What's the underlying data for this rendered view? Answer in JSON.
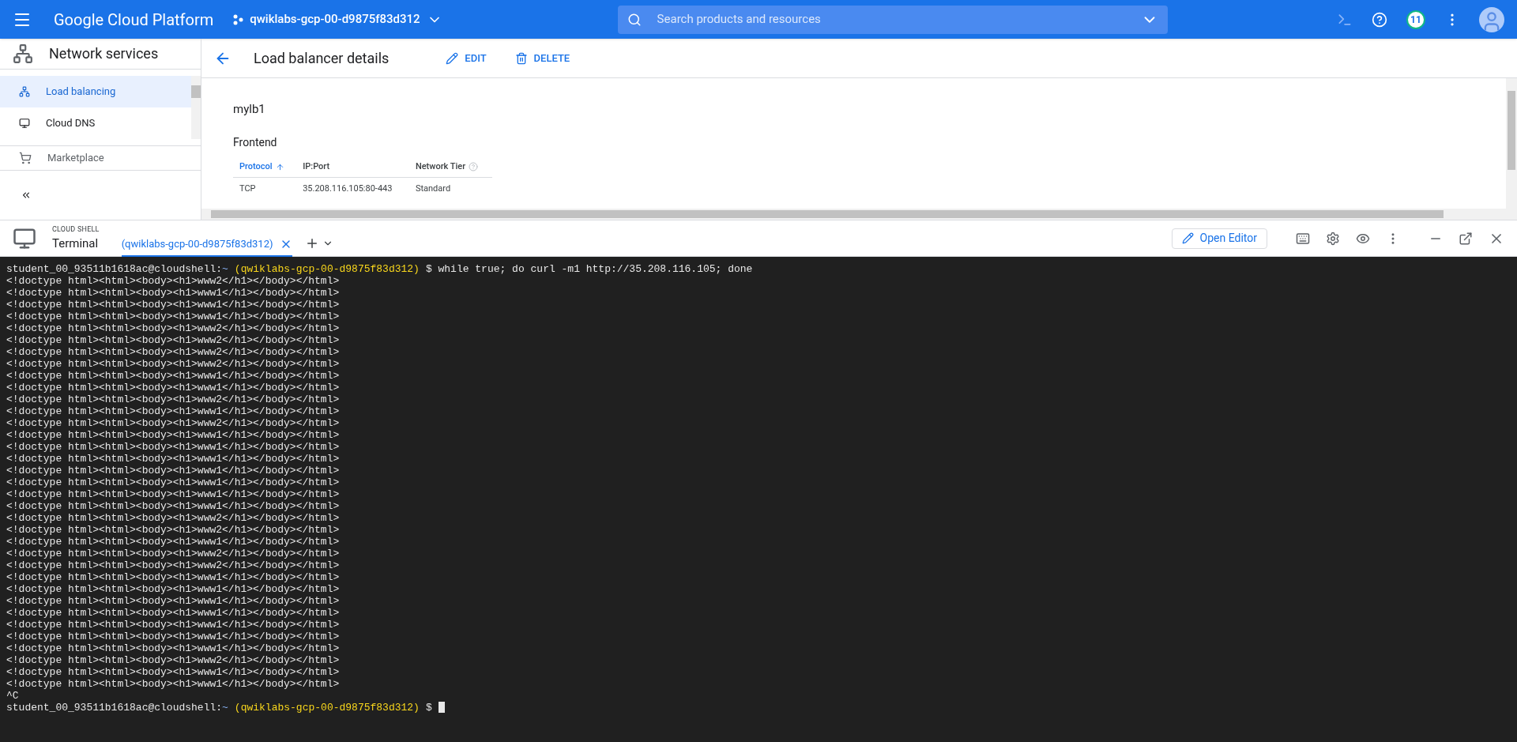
{
  "header": {
    "product": "Google Cloud Platform",
    "project": "qwiklabs-gcp-00-d9875f83d312",
    "search": {
      "placeholder": "Search products and resources"
    },
    "badge": "11"
  },
  "nav": {
    "title": "Network services",
    "items": [
      {
        "label": "Load balancing",
        "selected": true
      },
      {
        "label": "Cloud DNS",
        "selected": false
      }
    ],
    "extra": {
      "label": "Marketplace"
    }
  },
  "page": {
    "title": "Load balancer details",
    "actions": [
      {
        "label": "EDIT",
        "kind": "edit"
      },
      {
        "label": "DELETE",
        "kind": "delete"
      }
    ],
    "name": "mylb1",
    "section": "Frontend",
    "table": {
      "columns": [
        {
          "label": "Protocol",
          "sorted": true,
          "help": false
        },
        {
          "label": "IP:Port",
          "sorted": false,
          "help": false
        },
        {
          "label": "Network Tier",
          "sorted": false,
          "help": true
        }
      ],
      "rows": [
        [
          "TCP",
          "35.208.116.105:80-443",
          "Standard"
        ]
      ]
    }
  },
  "shell": {
    "label": "CLOUD SHELL",
    "title": "Terminal",
    "tabs": [
      {
        "label": "(qwiklabs-gcp-00-d9875f83d312)",
        "selected": true
      }
    ],
    "open_editor": "Open Editor"
  },
  "terminal": {
    "lines": [
      {
        "kind": "prompt",
        "user": "student_00_93511b1618ac@cloudshell:",
        "dir": "~",
        "project": "(qwiklabs-gcp-00-d9875f83d312)",
        "command": "$ while true; do curl -m1 http://35.208.116.105; done",
        "cursor": false
      },
      {
        "kind": "output",
        "text": "<!doctype html><html><body><h1>www2</h1></body></html>"
      },
      {
        "kind": "output",
        "text": "<!doctype html><html><body><h1>www1</h1></body></html>"
      },
      {
        "kind": "output",
        "text": "<!doctype html><html><body><h1>www1</h1></body></html>"
      },
      {
        "kind": "output",
        "text": "<!doctype html><html><body><h1>www1</h1></body></html>"
      },
      {
        "kind": "output",
        "text": "<!doctype html><html><body><h1>www2</h1></body></html>"
      },
      {
        "kind": "output",
        "text": "<!doctype html><html><body><h1>www2</h1></body></html>"
      },
      {
        "kind": "output",
        "text": "<!doctype html><html><body><h1>www2</h1></body></html>"
      },
      {
        "kind": "output",
        "text": "<!doctype html><html><body><h1>www2</h1></body></html>"
      },
      {
        "kind": "output",
        "text": "<!doctype html><html><body><h1>www1</h1></body></html>"
      },
      {
        "kind": "output",
        "text": "<!doctype html><html><body><h1>www1</h1></body></html>"
      },
      {
        "kind": "output",
        "text": "<!doctype html><html><body><h1>www2</h1></body></html>"
      },
      {
        "kind": "output",
        "text": "<!doctype html><html><body><h1>www1</h1></body></html>"
      },
      {
        "kind": "output",
        "text": "<!doctype html><html><body><h1>www2</h1></body></html>"
      },
      {
        "kind": "output",
        "text": "<!doctype html><html><body><h1>www1</h1></body></html>"
      },
      {
        "kind": "output",
        "text": "<!doctype html><html><body><h1>www1</h1></body></html>"
      },
      {
        "kind": "output",
        "text": "<!doctype html><html><body><h1>www1</h1></body></html>"
      },
      {
        "kind": "output",
        "text": "<!doctype html><html><body><h1>www1</h1></body></html>"
      },
      {
        "kind": "output",
        "text": "<!doctype html><html><body><h1>www1</h1></body></html>"
      },
      {
        "kind": "output",
        "text": "<!doctype html><html><body><h1>www1</h1></body></html>"
      },
      {
        "kind": "output",
        "text": "<!doctype html><html><body><h1>www1</h1></body></html>"
      },
      {
        "kind": "output",
        "text": "<!doctype html><html><body><h1>www2</h1></body></html>"
      },
      {
        "kind": "output",
        "text": "<!doctype html><html><body><h1>www2</h1></body></html>"
      },
      {
        "kind": "output",
        "text": "<!doctype html><html><body><h1>www1</h1></body></html>"
      },
      {
        "kind": "output",
        "text": "<!doctype html><html><body><h1>www2</h1></body></html>"
      },
      {
        "kind": "output",
        "text": "<!doctype html><html><body><h1>www2</h1></body></html>"
      },
      {
        "kind": "output",
        "text": "<!doctype html><html><body><h1>www1</h1></body></html>"
      },
      {
        "kind": "output",
        "text": "<!doctype html><html><body><h1>www1</h1></body></html>"
      },
      {
        "kind": "output",
        "text": "<!doctype html><html><body><h1>www1</h1></body></html>"
      },
      {
        "kind": "output",
        "text": "<!doctype html><html><body><h1>www1</h1></body></html>"
      },
      {
        "kind": "output",
        "text": "<!doctype html><html><body><h1>www1</h1></body></html>"
      },
      {
        "kind": "output",
        "text": "<!doctype html><html><body><h1>www1</h1></body></html>"
      },
      {
        "kind": "output",
        "text": "<!doctype html><html><body><h1>www1</h1></body></html>"
      },
      {
        "kind": "output",
        "text": "<!doctype html><html><body><h1>www2</h1></body></html>"
      },
      {
        "kind": "output",
        "text": "<!doctype html><html><body><h1>www1</h1></body></html>"
      },
      {
        "kind": "output",
        "text": "<!doctype html><html><body><h1>www1</h1></body></html>"
      },
      {
        "kind": "output",
        "text": "^C"
      },
      {
        "kind": "prompt",
        "user": "student_00_93511b1618ac@cloudshell:",
        "dir": "~",
        "project": "(qwiklabs-gcp-00-d9875f83d312)",
        "command": "$",
        "cursor": true
      }
    ]
  }
}
